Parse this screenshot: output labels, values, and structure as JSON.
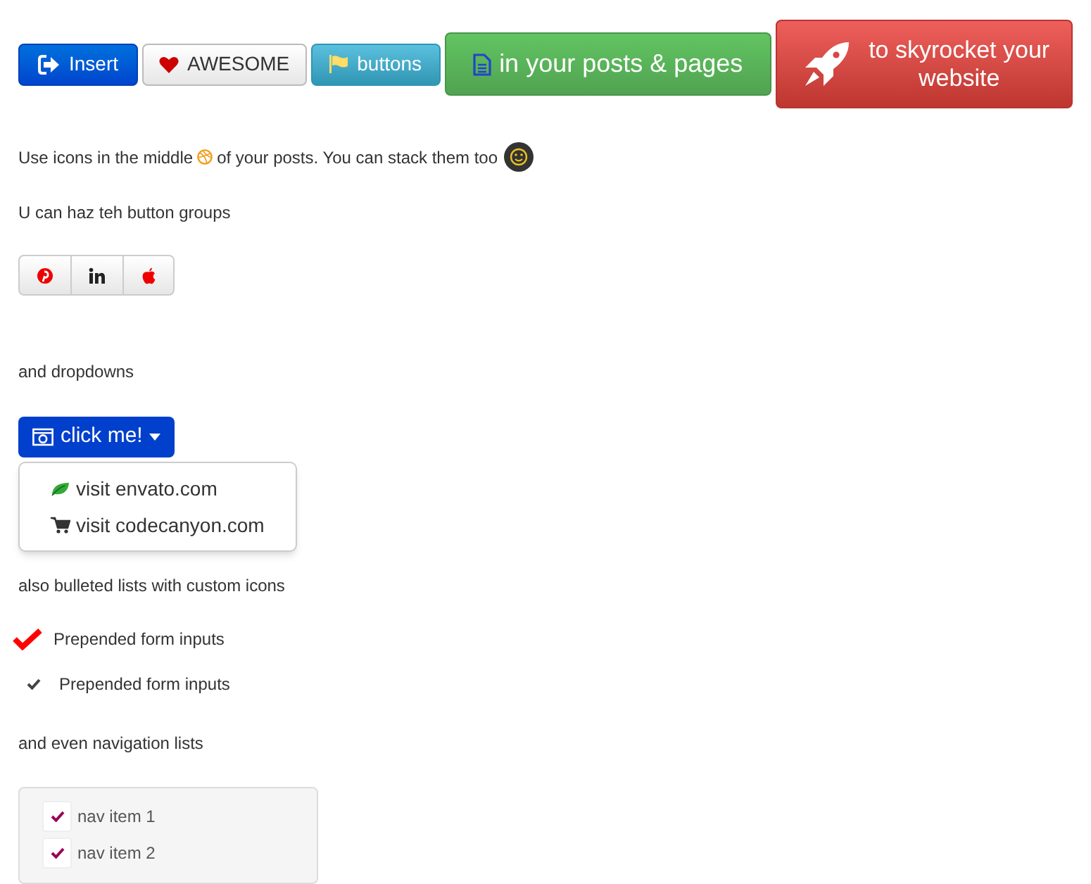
{
  "buttons": [
    {
      "label": "Insert",
      "kind": "primary"
    },
    {
      "label": "AWESOME",
      "kind": "default"
    },
    {
      "label": "buttons",
      "kind": "info"
    },
    {
      "label": "in your posts & pages",
      "kind": "success"
    },
    {
      "label": "to skyrocket your website",
      "kind": "danger"
    }
  ],
  "intro": {
    "before": "Use icons in the middle",
    "after": "of your posts. You can stack them too"
  },
  "group_caption": "U can haz teh button groups",
  "dropdown_caption": "and dropdowns",
  "dropdown": {
    "label": "click me!",
    "expanded": true,
    "items": [
      "visit envato.com",
      "visit codecanyon.com"
    ]
  },
  "list_caption": "also bulleted lists with custom icons",
  "bullets": [
    {
      "label": "Prepended form inputs",
      "kind": "large"
    },
    {
      "label": "Prepended form inputs",
      "kind": "small"
    }
  ],
  "nav_caption": "and even navigation lists",
  "nav_items": [
    "nav item 1",
    "nav item 2"
  ]
}
